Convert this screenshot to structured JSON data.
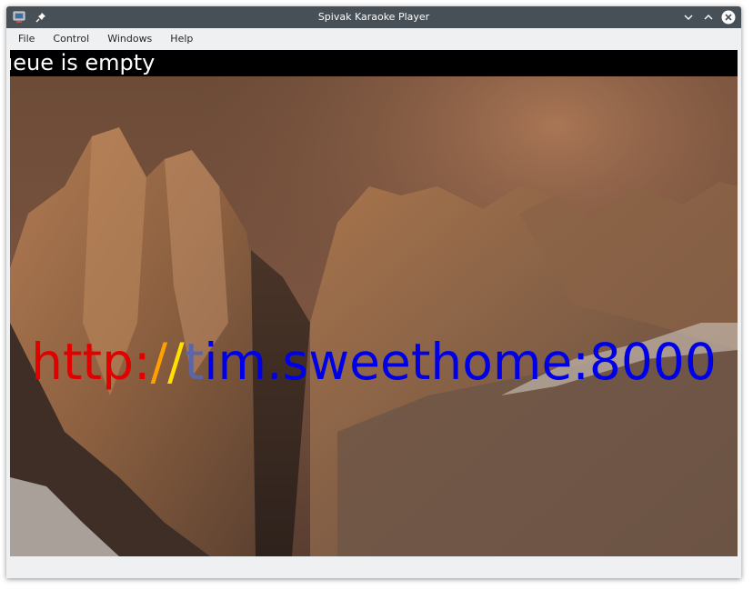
{
  "window": {
    "title": "Spivak Karaoke Player"
  },
  "titlebar_icons": {
    "app": "app-icon",
    "pin": "pin-icon",
    "minimize": "chevron-down-icon",
    "maximize": "chevron-up-icon",
    "close": "close-icon"
  },
  "menubar": {
    "items": [
      {
        "label": "File"
      },
      {
        "label": "Control"
      },
      {
        "label": "Windows"
      },
      {
        "label": "Help"
      }
    ]
  },
  "player": {
    "status_text": "ueue is empty",
    "url_parts": {
      "sung": "http:",
      "mid": "/",
      "current": "/",
      "grey": "t",
      "rest": "im.sweethome:8000"
    }
  },
  "colors": {
    "titlebar": "#475057",
    "sung": "#e00000",
    "highlight_orange": "#ffa000",
    "highlight_yellow": "#ffe000",
    "unsung": "#0000e6"
  }
}
